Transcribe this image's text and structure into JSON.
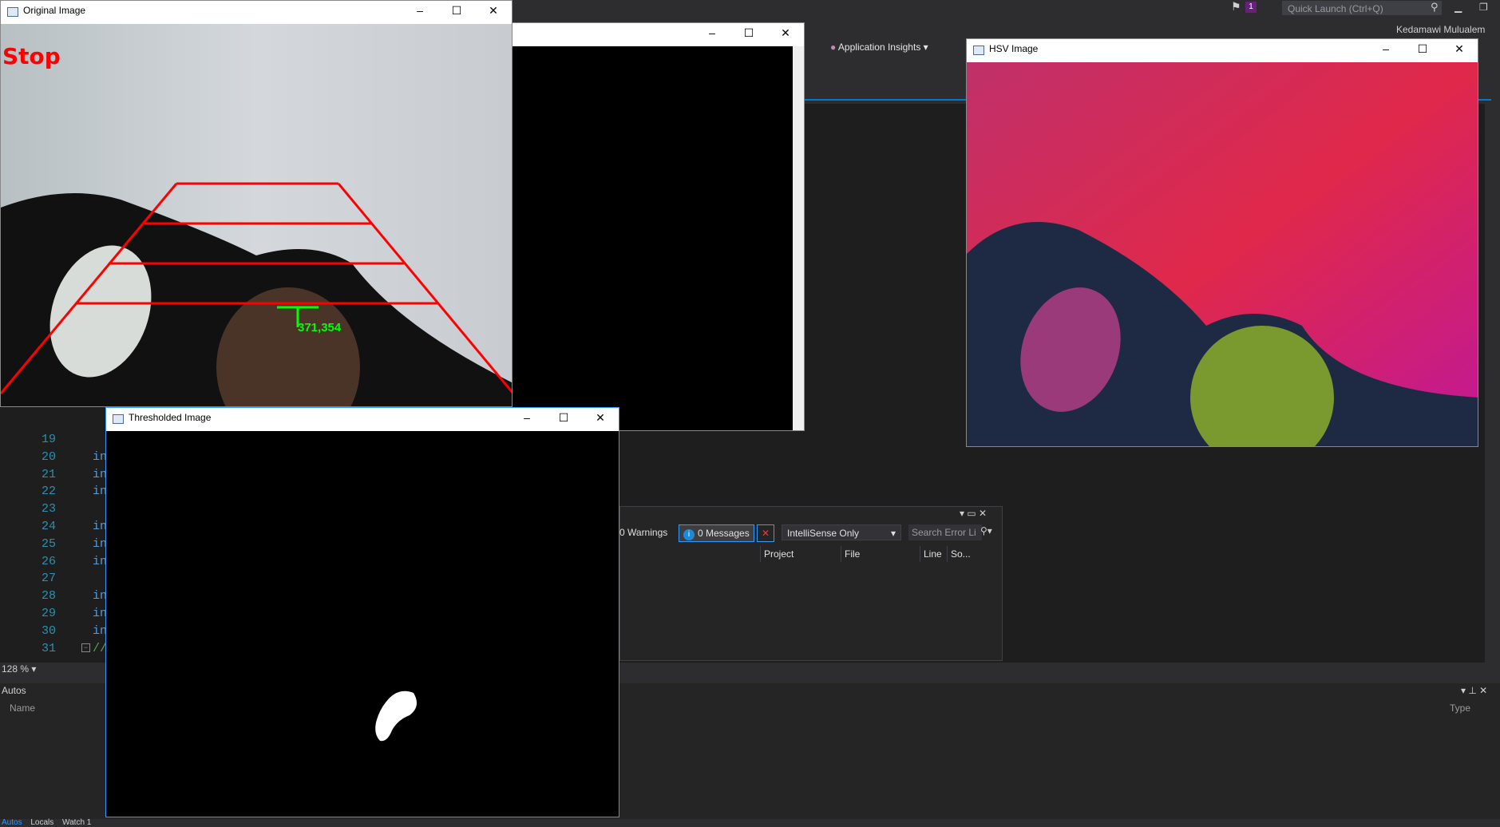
{
  "vs": {
    "quick_launch_placeholder": "Quick Launch (Ctrl+Q)",
    "notification_count": "1",
    "user_name": "Kedamawi Mulualem",
    "app_insights": "Application Insights",
    "zoom": "128 %",
    "code_lines": [
      {
        "num": "19",
        "code": ""
      },
      {
        "num": "20",
        "code": "in"
      },
      {
        "num": "21",
        "code": "in"
      },
      {
        "num": "22",
        "code": "in"
      },
      {
        "num": "23",
        "code": ""
      },
      {
        "num": "24",
        "code": "in"
      },
      {
        "num": "25",
        "code": "in"
      },
      {
        "num": "26",
        "code": "in"
      },
      {
        "num": "27",
        "code": ""
      },
      {
        "num": "28",
        "code": "in"
      },
      {
        "num": "29",
        "code": "in"
      },
      {
        "num": "30",
        "code": "in"
      },
      {
        "num": "31",
        "code": "//"
      }
    ]
  },
  "error_list": {
    "warnings": "0 Warnings",
    "messages": "0 Messages",
    "scope": "IntelliSense Only",
    "search_placeholder": "Search Error Li",
    "columns": [
      "Project",
      "File",
      "Line",
      "So..."
    ]
  },
  "autos": {
    "title": "Autos",
    "col_name": "Name",
    "col_type": "Type",
    "tabs": [
      "Autos",
      "Locals",
      "Watch 1"
    ]
  },
  "windows": {
    "original": {
      "title": "Original Image",
      "overlay_text": "Stop",
      "coord_label": "371,354"
    },
    "blank": {
      "title": ""
    },
    "hsv": {
      "title": "HSV Image"
    },
    "threshold": {
      "title": "Thresholded Image"
    }
  },
  "colors": {
    "accent": "#007acc",
    "overlay_red": "#ff0000",
    "overlay_green": "#00ff00"
  }
}
